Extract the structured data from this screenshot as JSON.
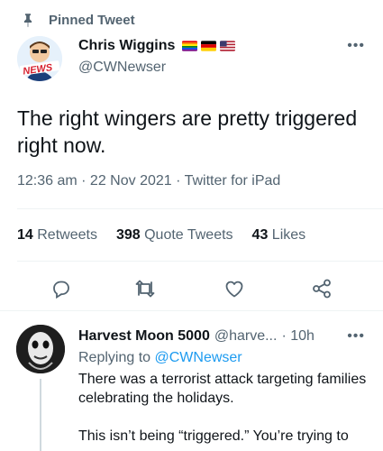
{
  "pinned": {
    "label": "Pinned Tweet",
    "icon": "pin-icon"
  },
  "tweet": {
    "author_name": "Chris Wiggins",
    "author_handle": "@CWNewser",
    "avatar_badge": "NEWS",
    "text": "The right wingers are pretty triggered right now.",
    "timestamp": "12:36 am · 22 Nov 2021 · Twitter for iPad",
    "stats": [
      {
        "count": "14",
        "label": "Retweets"
      },
      {
        "count": "398",
        "label": "Quote Tweets"
      },
      {
        "count": "43",
        "label": "Likes"
      }
    ],
    "actions": [
      "reply-icon",
      "retweet-icon",
      "like-icon",
      "share-icon"
    ],
    "flags": [
      "rainbow-flag",
      "germany-flag",
      "usa-flag"
    ]
  },
  "reply": {
    "name": "Harvest Moon 5000",
    "handle": "@harve...",
    "time": "· 10h",
    "replying_prefix": "Replying to",
    "replying_to": "@CWNewser",
    "text": "There was a terrorist attack targeting families celebrating the holidays.\n\nThis isn’t being “triggered.” You’re trying to"
  },
  "colors": {
    "accent": "#1d9bf0",
    "secondary_text": "#536471",
    "primary_text": "#0f1419"
  }
}
